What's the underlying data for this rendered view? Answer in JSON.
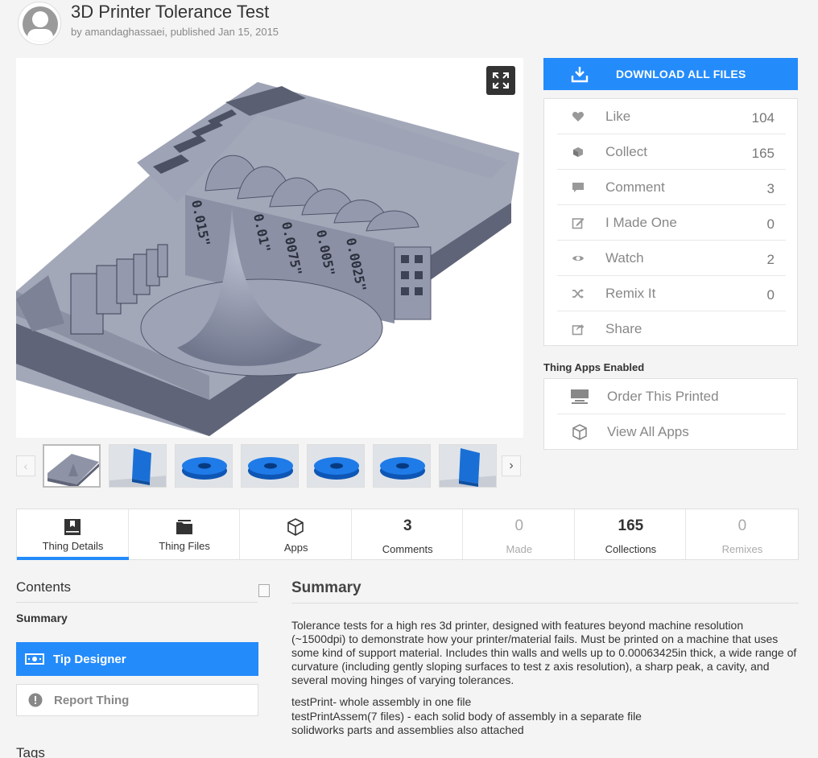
{
  "header": {
    "title": "3D Printer Tolerance Test",
    "byline": "by amandaghassaei, published Jan 15, 2015"
  },
  "viewer": {
    "expand_icon": "expand-icon",
    "engraved_labels": [
      "0.015\"",
      "0.01\"",
      "0.0075\"",
      "0.005\"",
      "0.0025\""
    ]
  },
  "thumbnails": [
    {
      "name": "gray-model"
    },
    {
      "name": "blue-wall"
    },
    {
      "name": "blue-ring"
    },
    {
      "name": "blue-ring"
    },
    {
      "name": "blue-ring"
    },
    {
      "name": "blue-ring"
    },
    {
      "name": "blue-wall"
    }
  ],
  "download": {
    "label": "DOWNLOAD ALL FILES",
    "icon": "download-icon"
  },
  "stats": [
    {
      "label": "Like",
      "count": "104",
      "icon": "heart-icon"
    },
    {
      "label": "Collect",
      "count": "165",
      "icon": "collect-icon"
    },
    {
      "label": "Comment",
      "count": "3",
      "icon": "comment-icon"
    },
    {
      "label": "I Made One",
      "count": "0",
      "icon": "edit-icon"
    },
    {
      "label": "Watch",
      "count": "2",
      "icon": "eye-icon"
    },
    {
      "label": "Remix It",
      "count": "0",
      "icon": "shuffle-icon"
    },
    {
      "label": "Share",
      "count": "",
      "icon": "share-icon"
    }
  ],
  "apps": {
    "title": "Thing Apps Enabled",
    "items": [
      {
        "label": "Order This Printed",
        "icon": "printer-icon"
      },
      {
        "label": "View All Apps",
        "icon": "cube-icon"
      }
    ]
  },
  "tabs": {
    "details": "Thing Details",
    "files": "Thing Files",
    "apps": "Apps",
    "comments_count": "3",
    "comments": "Comments",
    "made_count": "0",
    "made": "Made",
    "collections_count": "165",
    "collections": "Collections",
    "remixes_count": "0",
    "remixes": "Remixes"
  },
  "sidebar": {
    "contents_title": "Contents",
    "contents_item": "Summary",
    "tip_label": "Tip Designer",
    "report_label": "Report Thing",
    "tags_title": "Tags"
  },
  "summary": {
    "title": "Summary",
    "body": "Tolerance tests for a high res 3d printer, designed with features beyond machine resolution (~1500dpi) to demonstrate how your printer/material fails. Must be printed on a machine that uses some kind of support material. Includes thin walls and wells up to 0.00063425in thick, a wide range of curvature (including gently sloping surfaces to test z axis resolution), a sharp peak, a cavity, and several moving hinges of varying tolerances.",
    "lines": [
      "testPrint- whole assembly in one file",
      "testPrintAssem(7 files) - each solid body of assembly in a separate file",
      "solidworks parts and assemblies also attached"
    ]
  },
  "colors": {
    "accent": "#248bfb",
    "model_gray": "#8e93a6"
  }
}
